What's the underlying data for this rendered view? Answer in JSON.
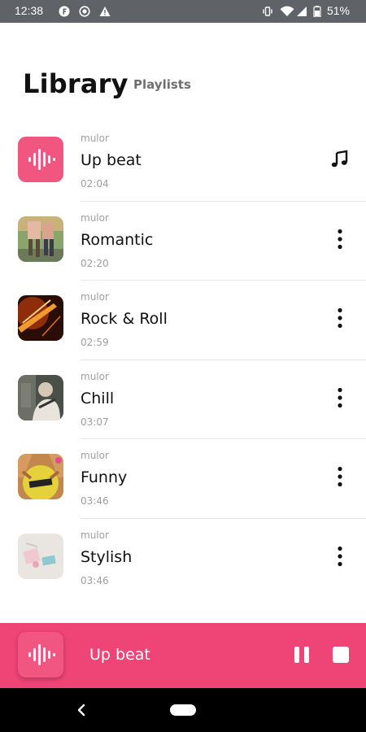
{
  "status_bar": {
    "time": "12:38",
    "battery": "51%",
    "icons": [
      "notification-f-icon",
      "screen-record-icon",
      "warning-icon",
      "vibrate-icon",
      "wifi-icon",
      "signal-icon",
      "battery-icon"
    ]
  },
  "header": {
    "title": "Library",
    "tab": "Playlists"
  },
  "songs": [
    {
      "artist": "mulor",
      "title": "Up beat",
      "duration": "02:04",
      "action": "music-note-icon",
      "cover": "waveform-cover"
    },
    {
      "artist": "mulor",
      "title": "Romantic",
      "duration": "02:20",
      "action": "more-vert-icon",
      "cover": "photo-cover"
    },
    {
      "artist": "mulor",
      "title": "Rock & Roll",
      "duration": "02:59",
      "action": "more-vert-icon",
      "cover": "photo-cover"
    },
    {
      "artist": "mulor",
      "title": "Chill",
      "duration": "03:07",
      "action": "more-vert-icon",
      "cover": "photo-cover"
    },
    {
      "artist": "mulor",
      "title": "Funny",
      "duration": "03:46",
      "action": "more-vert-icon",
      "cover": "photo-cover"
    },
    {
      "artist": "mulor",
      "title": "Stylish",
      "duration": "03:46",
      "action": "more-vert-icon",
      "cover": "photo-cover"
    }
  ],
  "player": {
    "title": "Up beat",
    "controls": [
      "pause-icon",
      "stop-icon"
    ]
  },
  "colors": {
    "accent": "#ef4476",
    "status_bar": "#5f6368",
    "nav_bar": "#000000"
  }
}
